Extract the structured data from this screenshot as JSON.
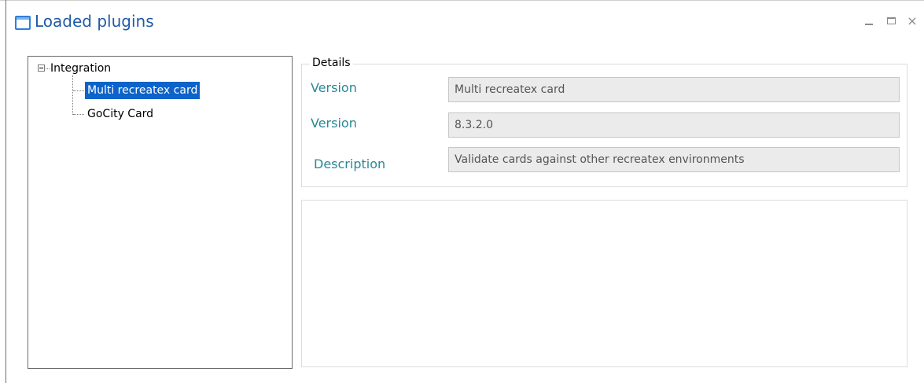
{
  "window": {
    "title": "Loaded plugins",
    "icon": "window-icon",
    "controls": {
      "minimize": "minimize-icon",
      "maximize": "maximize-icon",
      "close": "×"
    }
  },
  "tree": {
    "root": {
      "label": "Integration",
      "expanded": true
    },
    "children": [
      {
        "label": "Multi recreatex card",
        "selected": true
      },
      {
        "label": "GoCity Card",
        "selected": false
      }
    ]
  },
  "details": {
    "group_title": "Details",
    "fields": [
      {
        "label": "Version",
        "value": "Multi recreatex card"
      },
      {
        "label": "Version",
        "value": "8.3.2.0"
      },
      {
        "label": "Description",
        "value": "Validate cards against other recreatex environments"
      }
    ]
  },
  "colors": {
    "title": "#1f5aa6",
    "selection": "#0d63c9",
    "field_label": "#2a8796",
    "field_background": "#ebebeb"
  }
}
